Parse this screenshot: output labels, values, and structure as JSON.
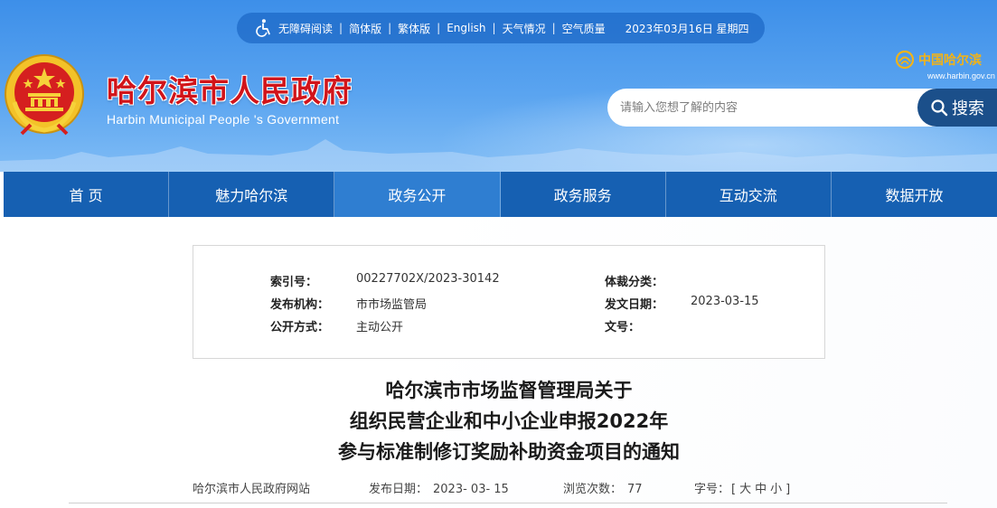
{
  "topbar": {
    "items": [
      "无障碍阅读",
      "简体版",
      "繁体版",
      "English",
      "天气情况",
      "空气质量"
    ],
    "date": "2023年03月16日 星期四"
  },
  "header": {
    "title": "哈尔滨市人民政府",
    "subtitle": "Harbin Municipal People 's Government",
    "brand_logo": "中国哈尔滨",
    "brand_url": "www.harbin.gov.cn"
  },
  "search": {
    "placeholder": "请输入您想了解的内容",
    "button_label": "搜索"
  },
  "nav": {
    "items": [
      "首 页",
      "魅力哈尔滨",
      "政务公开",
      "政务服务",
      "互动交流",
      "数据开放"
    ],
    "active_index": 2
  },
  "meta": {
    "index_no_label": "索引号：",
    "index_no": "00227702X/2023-30142",
    "genre_label": "体裁分类：",
    "genre": "",
    "publisher_label": "发布机构：",
    "publisher": "市市场监管局",
    "doc_date_label": "发文日期：",
    "doc_date": "2023-03-15",
    "open_mode_label": "公开方式：",
    "open_mode": "主动公开",
    "doc_no_label": "文号：",
    "doc_no": ""
  },
  "article": {
    "title_lines": [
      "哈尔滨市市场监督管理局关于",
      "组织民营企业和中小企业申报2022年",
      "参与标准制修订奖励补助资金项目的通知"
    ],
    "source": "哈尔滨市人民政府网站",
    "publish_date_label": "发布日期：",
    "publish_date": "2023- 03- 15",
    "views_label": "浏览次数：",
    "views": "77",
    "font_size_label": "字号：",
    "font_size_open": "[",
    "font_sizes": [
      "大",
      "中",
      "小"
    ],
    "font_size_close": "]"
  },
  "colors": {
    "header_blue": "#3d8fe9",
    "nav_blue": "#1660b2",
    "nav_active": "#2f7ed1",
    "title_red": "#d1141a",
    "search_button": "#1b4f8a"
  },
  "icons": [
    "accessibility-icon",
    "national-emblem-icon",
    "harbin-logo-icon",
    "search-icon"
  ]
}
